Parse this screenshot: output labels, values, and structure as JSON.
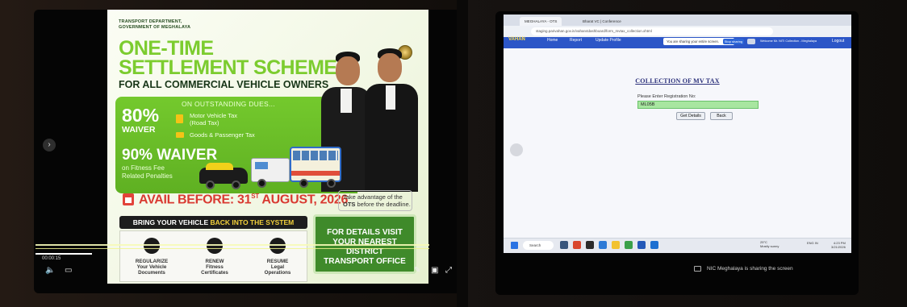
{
  "poster": {
    "dept_line1": "TRANSPORT DEPARTMENT,",
    "dept_line2": "GOVERNMENT OF MEGHALAYA",
    "title_line1": "ONE-TIME",
    "title_line2": "SETTLEMENT SCHEME",
    "subtitle": "FOR ALL COMMERCIAL VEHICLE OWNERS",
    "on_outstanding": "ON OUTSTANDING DUES...",
    "pct80": "80%",
    "waiver": "WAIVER",
    "mv_tax_line1": "Motor Vehicle Tax",
    "mv_tax_line2": "(Road Tax)",
    "goods_tax": "Goods & Passenger Tax",
    "pct90_waiver": "90% WAIVER",
    "fitness_line1": "on Fitness Fee",
    "fitness_line2": "Related Penalties",
    "avail_prefix": "AVAIL BEFORE: 31",
    "avail_sup": "ST",
    "avail_suffix": " AUGUST, 2026",
    "take_line1": "Take advantage of the",
    "take_bold": "OTS",
    "take_line2": " before the deadline.",
    "bring_prefix": "BRING YOUR VEHICLE ",
    "bring_highlight": "BACK INTO THE SYSTEM",
    "card1_line1": "REGULARIZE",
    "card1_line2": "Your Vehicle",
    "card1_line3": "Documents",
    "card2_line1": "RENEW",
    "card2_line2": "Fitness",
    "card2_line3": "Certificates",
    "card3_line1": "RESUME",
    "card3_line2": "Legal",
    "card3_line3": "Operations",
    "details_line1": "FOR DETAILS VISIT",
    "details_line2": "YOUR NEAREST DISTRICT",
    "details_line3": "TRANSPORT OFFICE"
  },
  "video": {
    "time": "00:00:15"
  },
  "browser": {
    "tab1": "MEGHALAYA - OTS",
    "tab2": "Bharat VC | Conference",
    "url": "staging.parivahan.gov.in/vahan4dashboard/form_mvtax_collection.xhtml",
    "nav_logo": "VAHAN",
    "nav_home": "Home",
    "nav_report": "Report",
    "nav_update": "Update Profile",
    "share_text": "You are sharing your entire screen.",
    "stop_sharing": "Stop sharing",
    "welcome": "Welcome Mr. NITI Collection - Meghalaya",
    "logout": "Logout",
    "heading": "COLLECTION OF MV TAX",
    "reg_label": "Please Enter Registration No:",
    "reg_value": "ML05B",
    "get_details": "Get Details",
    "back": "Back",
    "search": "Search",
    "weather_temp": "25°C",
    "weather_desc": "Mostly sunny",
    "tray_lang": "ENG IN",
    "tray_time": "4:23 PM",
    "tray_date": "3/21/2026"
  },
  "meeting": {
    "sharing_note": "NIC Meghalaya is sharing the screen"
  },
  "colors": {
    "poster_green": "#7ccc2f",
    "accent_red": "#d93a31",
    "nav_blue": "#2c56c7",
    "input_green": "#a8e6a0"
  }
}
